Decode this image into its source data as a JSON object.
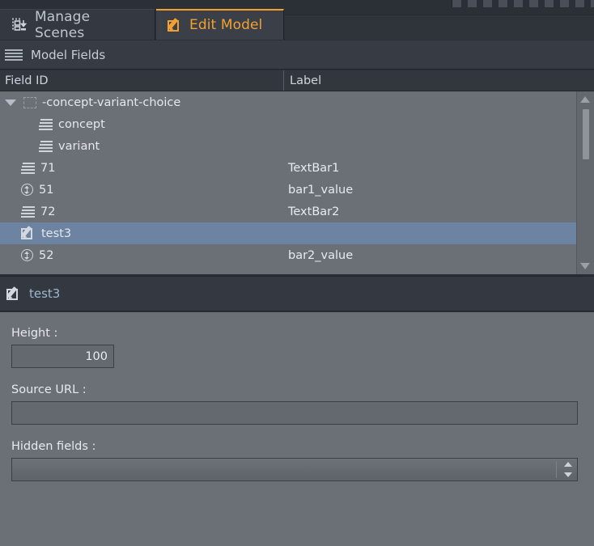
{
  "window": {
    "top_strip": "striped-drag-strip"
  },
  "tabs": [
    {
      "label": "Manage Scenes",
      "icon": "scenes-import-icon",
      "active": false
    },
    {
      "label": "Edit Model",
      "icon": "edit-model-pencil-icon",
      "active": true
    }
  ],
  "panel": {
    "title": "Model Fields",
    "icon": "menu-bars-icon"
  },
  "table": {
    "columns": [
      "Field ID",
      "Label"
    ],
    "rows": [
      {
        "id": "-concept-variant-choice",
        "label": "",
        "icon": "dashed-group-icon",
        "expander": "triangle-down-icon",
        "indent": 0,
        "selected": false
      },
      {
        "id": "concept",
        "label": "",
        "icon": "text-lines-icon",
        "indent": 1,
        "selected": false
      },
      {
        "id": "variant",
        "label": "",
        "icon": "text-lines-icon",
        "indent": 1,
        "selected": false
      },
      {
        "id": "71",
        "label": "TextBar1",
        "icon": "text-lines-icon",
        "indent": 2,
        "selected": false
      },
      {
        "id": "51",
        "label": "bar1_value",
        "icon": "circle-updown-arrow-icon",
        "indent": 2,
        "selected": false
      },
      {
        "id": "72",
        "label": "TextBar2",
        "icon": "text-lines-icon",
        "indent": 2,
        "selected": false
      },
      {
        "id": "test3",
        "label": "",
        "icon": "edit-model-pencil-icon",
        "indent": 2,
        "selected": true
      },
      {
        "id": "52",
        "label": "bar2_value",
        "icon": "circle-updown-arrow-icon",
        "indent": 2,
        "selected": false
      }
    ],
    "scrollbar": {
      "up_arrow": "scroll-up-icon",
      "down_arrow": "scroll-down-icon"
    }
  },
  "detail": {
    "title": "test3",
    "icon": "edit-model-pencil-icon",
    "fields": {
      "height": {
        "label": "Height :",
        "value": "100",
        "placeholder": ""
      },
      "source_url": {
        "label": "Source URL :",
        "value": "",
        "placeholder": ""
      },
      "hidden_fields": {
        "label": "Hidden fields :",
        "value": "",
        "placeholder": ""
      }
    }
  },
  "colors": {
    "accent": "#f2a131",
    "selection": "#6d83a2",
    "panel_bg": "#6b7076",
    "chrome_bg": "#2b2f36",
    "label_text": "#9fb6cf"
  }
}
